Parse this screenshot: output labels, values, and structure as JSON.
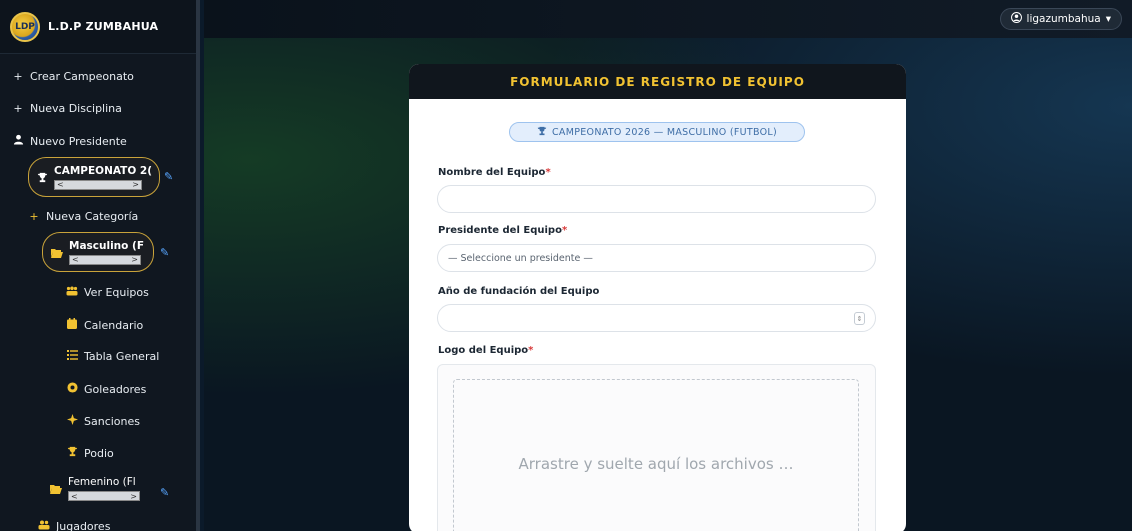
{
  "brand": {
    "name": "L.D.P ZUMBAHUA",
    "logo_icon": "league-logo-icon"
  },
  "sidebar": {
    "items": {
      "crear_campeonato": "Crear Campeonato",
      "nueva_disciplina": "Nueva Disciplina",
      "nuevo_presidente": "Nuevo Presidente",
      "campeonato": "CAMPEONATO 2(",
      "nueva_categoria": "Nueva Categoría",
      "masculino": "Masculino (F",
      "ver_equipos": "Ver Equipos",
      "calendario": "Calendario",
      "tabla_general": "Tabla General",
      "goleadores": "Goleadores",
      "sanciones": "Sanciones",
      "podio": "Podio",
      "femenino": "Femenino (Fl",
      "jugadores": "Jugadores"
    },
    "scroll_left": "<",
    "scroll_right": ">",
    "plus": "+"
  },
  "topbar": {
    "user": "ligazumbahua",
    "user_caret": "▾"
  },
  "form": {
    "title": "FORMULARIO DE REGISTRO DE EQUIPO",
    "badge": "CAMPEONATO 2026 — MASCULINO (FUTBOL)",
    "required_mark": "*",
    "nombre_label": "Nombre del Equipo",
    "nombre_value": "",
    "presidente_label": "Presidente del Equipo",
    "presidente_selected": "— Seleccione un presidente —",
    "anio_label": "Año de fundación del Equipo",
    "anio_value": "",
    "logo_label": "Logo del Equipo",
    "dropzone_text": "Arrastre y suelte aquí los archivos …"
  },
  "colors": {
    "accent_gold": "#f1c232",
    "link_blue": "#58a6ff",
    "required_red": "#d83a3a",
    "badge_text": "#3f6ea6"
  }
}
